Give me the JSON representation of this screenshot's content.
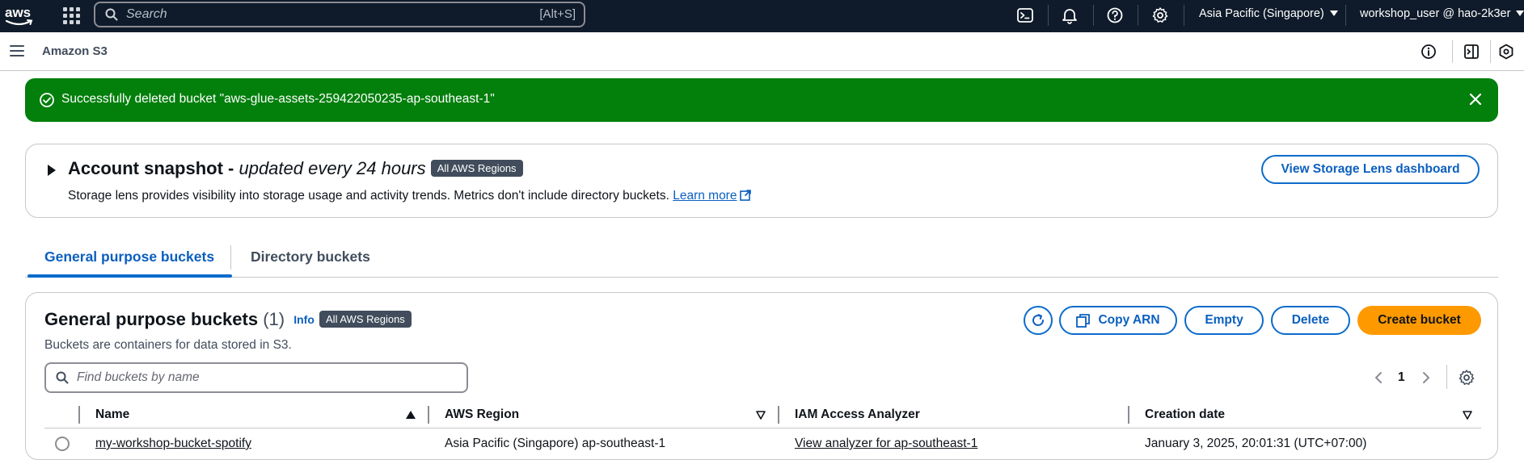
{
  "topnav": {
    "logo_text": "aws",
    "search_placeholder": "Search",
    "search_shortcut": "[Alt+S]",
    "region": "Asia Pacific (Singapore)",
    "account": "workshop_user @ hao-2k3er",
    "icons": [
      "apps-grid-icon",
      "cloudshell-icon",
      "bell-icon",
      "help-icon",
      "gear-icon"
    ]
  },
  "subbar": {
    "service": "Amazon S3",
    "icons": [
      "info-circle-icon",
      "split-panel-icon",
      "hexagon-icon"
    ]
  },
  "flash": {
    "message": "Successfully deleted bucket \"aws-glue-assets-259422050235-ap-southeast-1\"",
    "type": "success",
    "color": "#037f0c"
  },
  "snapshot": {
    "title": "Account snapshot -",
    "title_italic": "updated every 24 hours",
    "badge": "All AWS Regions",
    "description": "Storage lens provides visibility into storage usage and activity trends. Metrics don't include directory buckets.",
    "learn_more": "Learn more",
    "button": "View Storage Lens dashboard"
  },
  "tabs": [
    {
      "label": "General purpose buckets",
      "active": true
    },
    {
      "label": "Directory buckets",
      "active": false
    }
  ],
  "buckets": {
    "title": "General purpose buckets",
    "count": "(1)",
    "info": "Info",
    "badge": "All AWS Regions",
    "description": "Buckets are containers for data stored in S3.",
    "buttons": {
      "copy_arn": "Copy ARN",
      "empty": "Empty",
      "delete": "Delete",
      "create": "Create bucket"
    },
    "search_placeholder": "Find buckets by name",
    "page": "1",
    "columns": [
      "Name",
      "AWS Region",
      "IAM Access Analyzer",
      "Creation date"
    ],
    "rows": [
      {
        "name": "my-workshop-bucket-spotify",
        "region": "Asia Pacific (Singapore) ap-southeast-1",
        "analyzer": "View analyzer for ap-southeast-1",
        "created": "January 3, 2025, 20:01:31 (UTC+07:00)"
      }
    ]
  },
  "colors": {
    "nav_bg": "#0f1b2a",
    "primary_link": "#0b5fbf",
    "create_button": "#ff9900",
    "success": "#037f0c"
  }
}
